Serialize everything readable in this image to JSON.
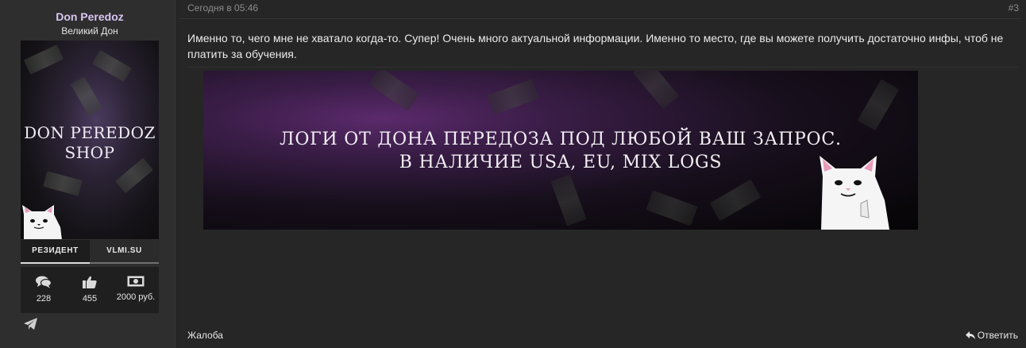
{
  "user": {
    "name": "Don Peredoz",
    "title": "Великий Дон",
    "avatar_text_line1": "DON PEREDOZ",
    "avatar_text_line2": "SHOP",
    "banners": [
      "РЕЗИДЕНТ",
      "VLMI.SU"
    ],
    "stats": [
      {
        "icon": "messages-icon",
        "value": "228"
      },
      {
        "icon": "likes-icon",
        "value": "455"
      },
      {
        "icon": "money-icon",
        "value": "2000 руб."
      }
    ],
    "contact_icon": "telegram-icon"
  },
  "post": {
    "date": "Сегодня в 05:46",
    "number": "#3",
    "message": "Именно то, чего мне не хватало когда-то. Супер! Очень много актуальной информации. Именно то место, где вы можете получить достаточно инфы, чтоб не платить за обучения.",
    "banner_line1": "ЛОГИ ОТ ДОНА ПЕРЕДОЗА ПОД ЛЮБОЙ ВАШ ЗАПРОС.",
    "banner_line2": "В НАЛИЧИЕ USA, EU, MIX LOGS"
  },
  "actions": {
    "report": "Жалоба",
    "reply": "Ответить"
  },
  "colors": {
    "background": "#262626",
    "sidebar": "#2e2e2e",
    "username": "#d8c6f2",
    "muted": "#8c8c8c"
  }
}
